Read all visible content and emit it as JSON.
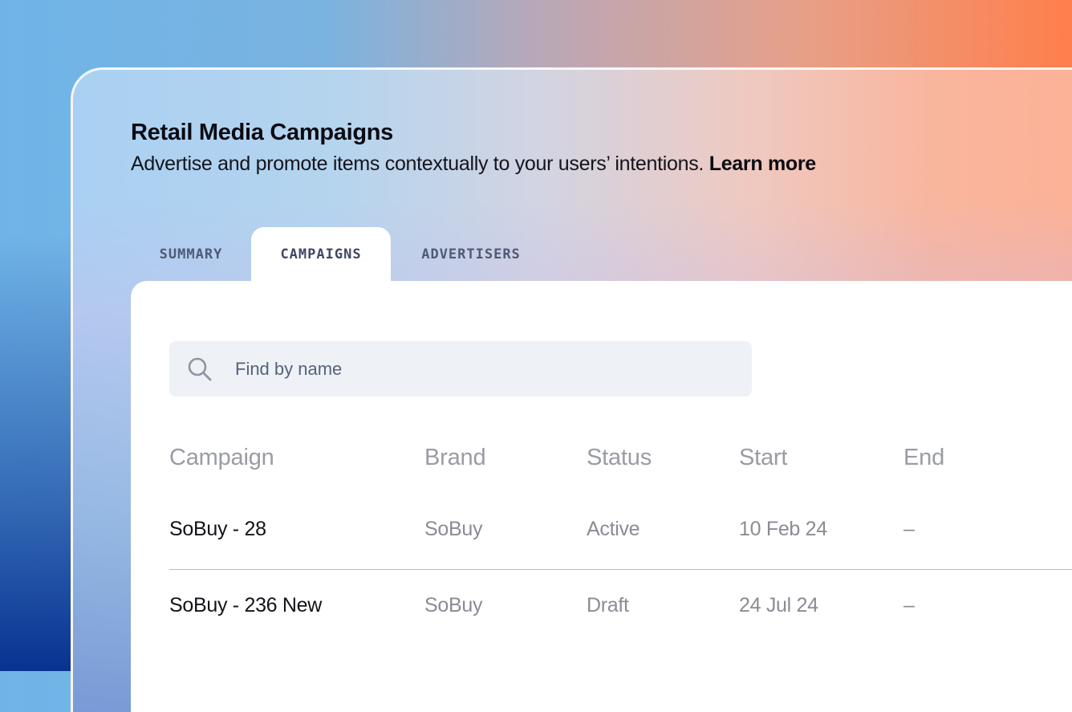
{
  "header": {
    "title": "Retail Media Campaigns",
    "subtitle": "Advertise and promote items contextually to your users’ intentions.",
    "learn_more": "Learn more"
  },
  "tabs": [
    {
      "label": "SUMMARY",
      "active": false
    },
    {
      "label": "CAMPAIGNS",
      "active": true
    },
    {
      "label": "ADVERTISERS",
      "active": false
    }
  ],
  "search": {
    "placeholder": "Find by name",
    "value": "",
    "icon": "search-icon"
  },
  "table": {
    "columns": [
      "Campaign",
      "Brand",
      "Status",
      "Start",
      "End"
    ],
    "rows": [
      {
        "campaign": "SoBuy - 28",
        "brand": "SoBuy",
        "status": "Active",
        "start": "10 Feb 24",
        "end": "–"
      },
      {
        "campaign": "SoBuy - 236 New",
        "brand": "SoBuy",
        "status": "Draft",
        "start": "24 Jul 24",
        "end": "–"
      }
    ]
  },
  "colors": {
    "background_left": "#6fb4e8",
    "background_right": "#ff7f4c",
    "card": "#ffffff",
    "search_bg": "#eef2f7"
  }
}
